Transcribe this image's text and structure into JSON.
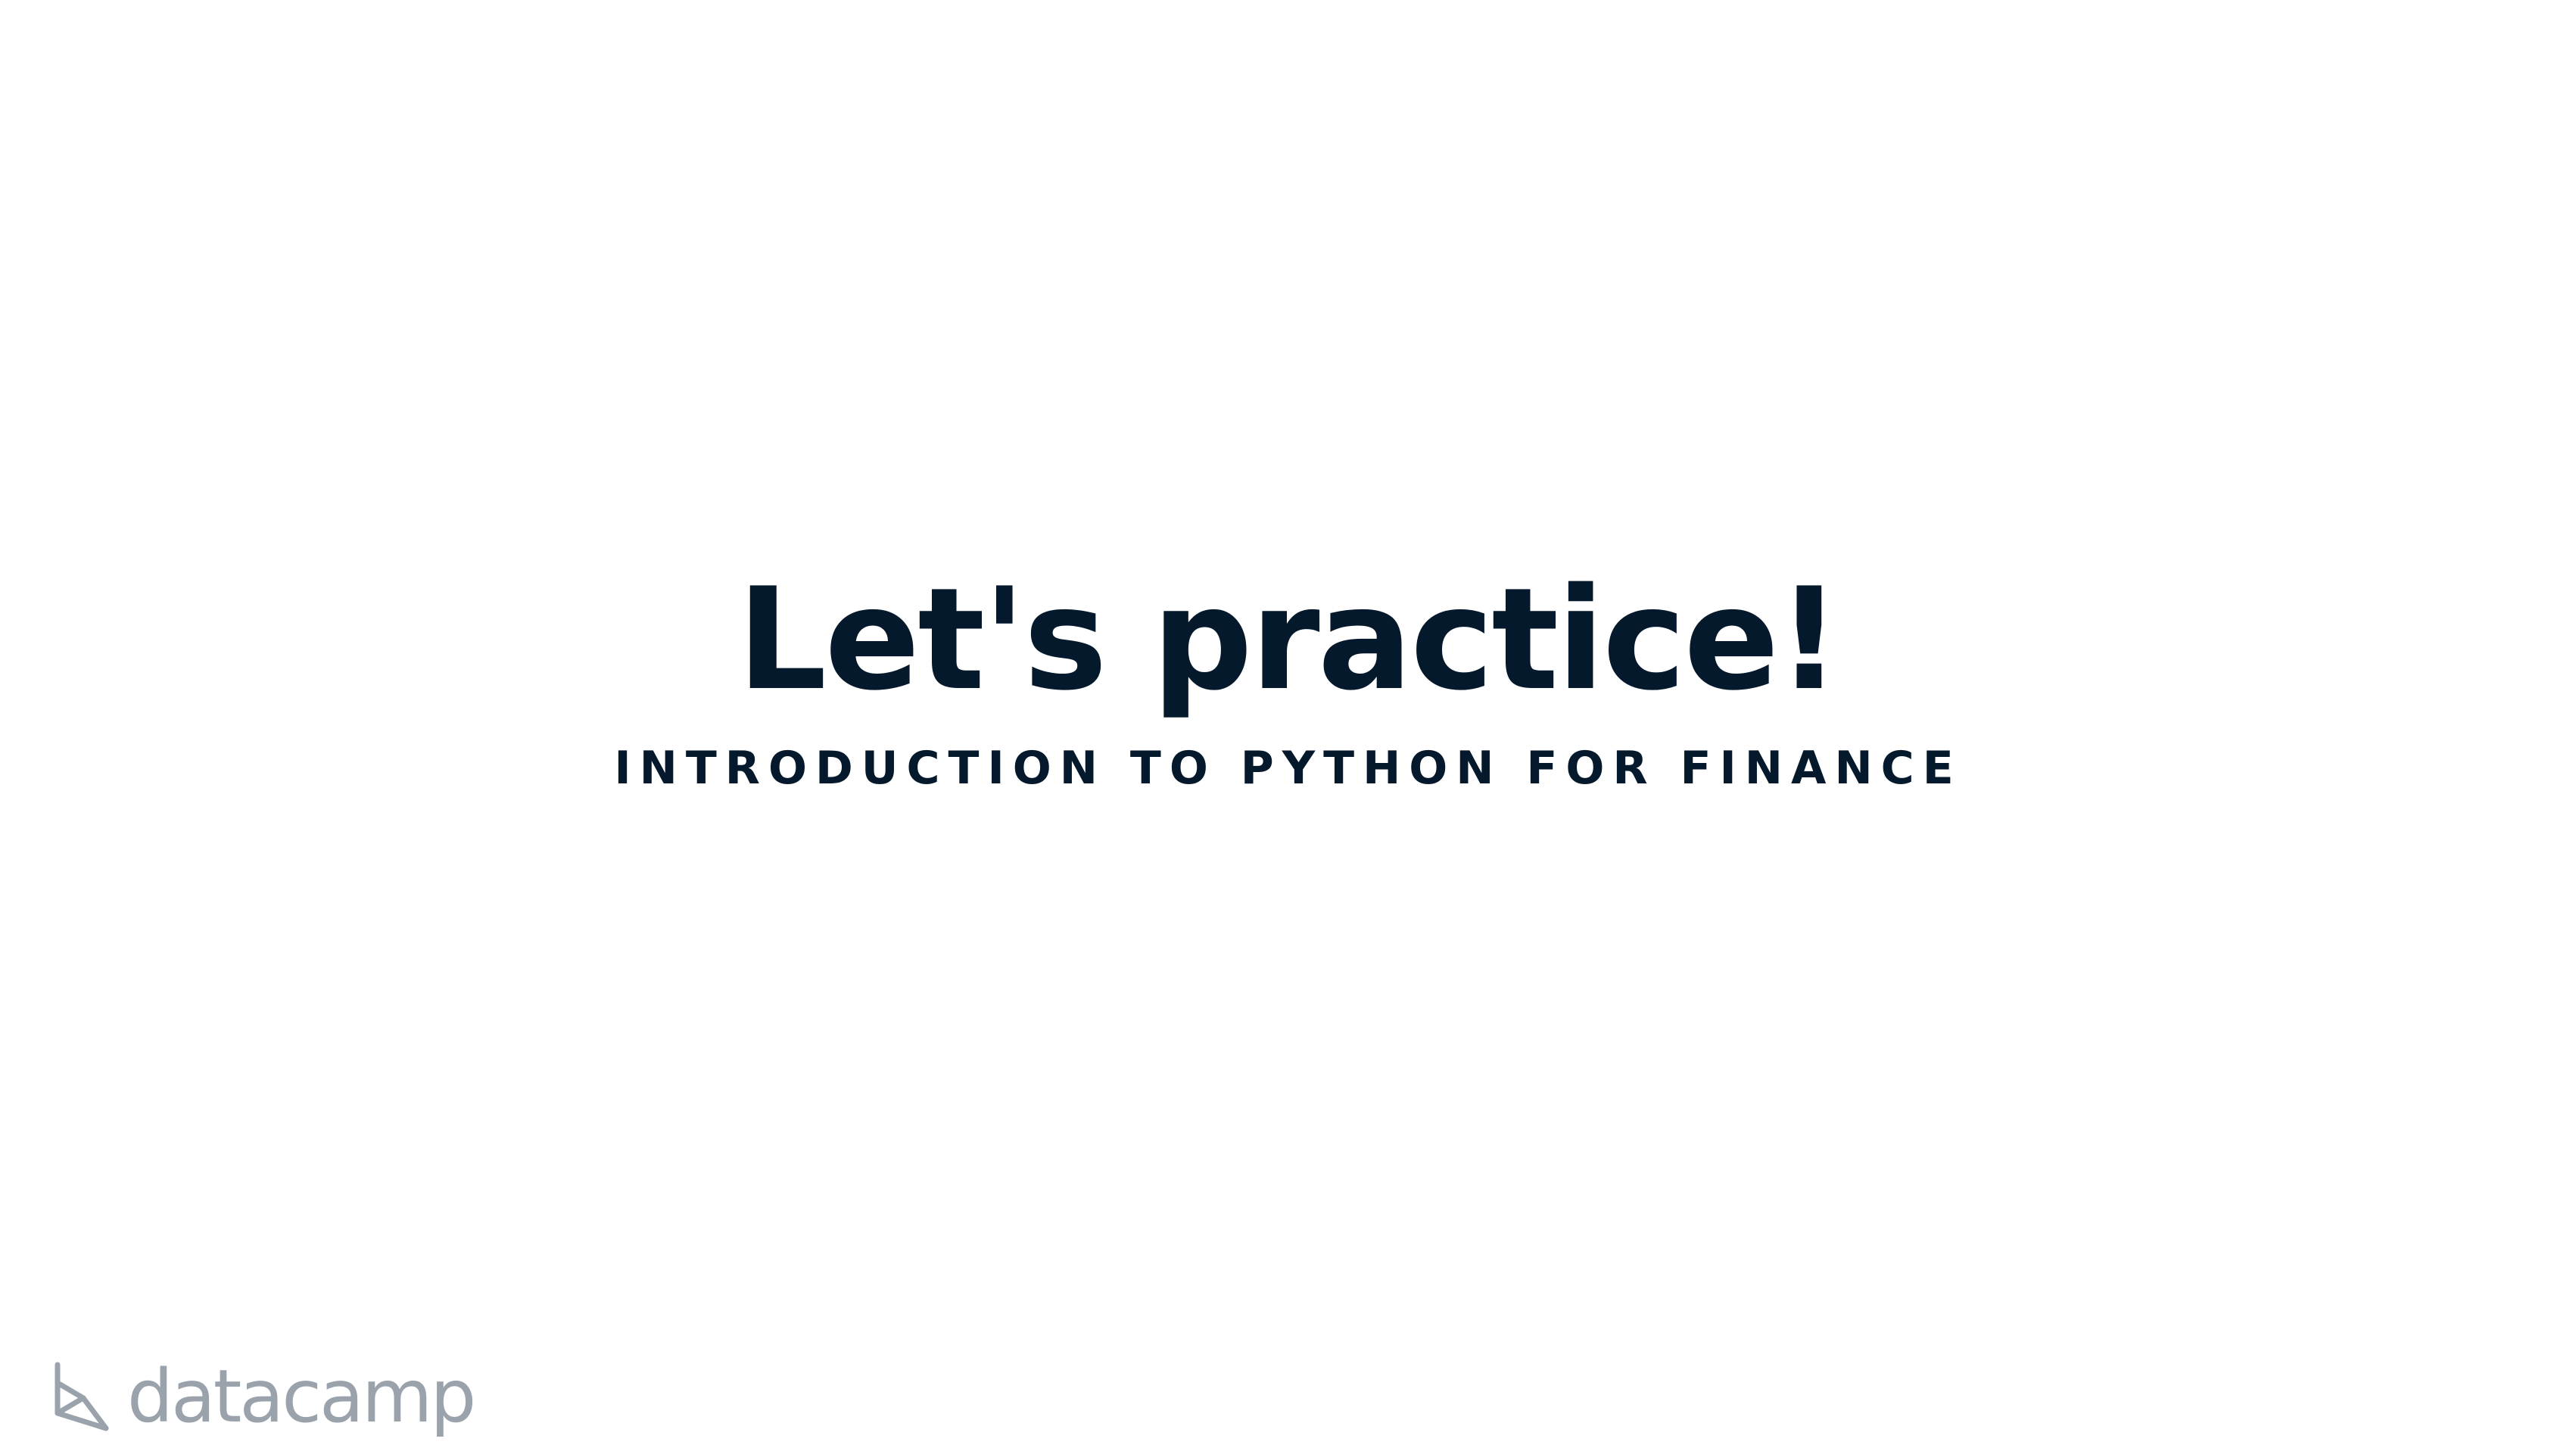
{
  "slide": {
    "title": "Let's practice!",
    "subtitle": "INTRODUCTION TO PYTHON FOR FINANCE"
  },
  "branding": {
    "logo_icon": "datacamp-logo-icon",
    "logo_text": "datacamp",
    "logo_color": "#9aa2ac"
  },
  "colors": {
    "text": "#05192d",
    "background": "#ffffff"
  }
}
